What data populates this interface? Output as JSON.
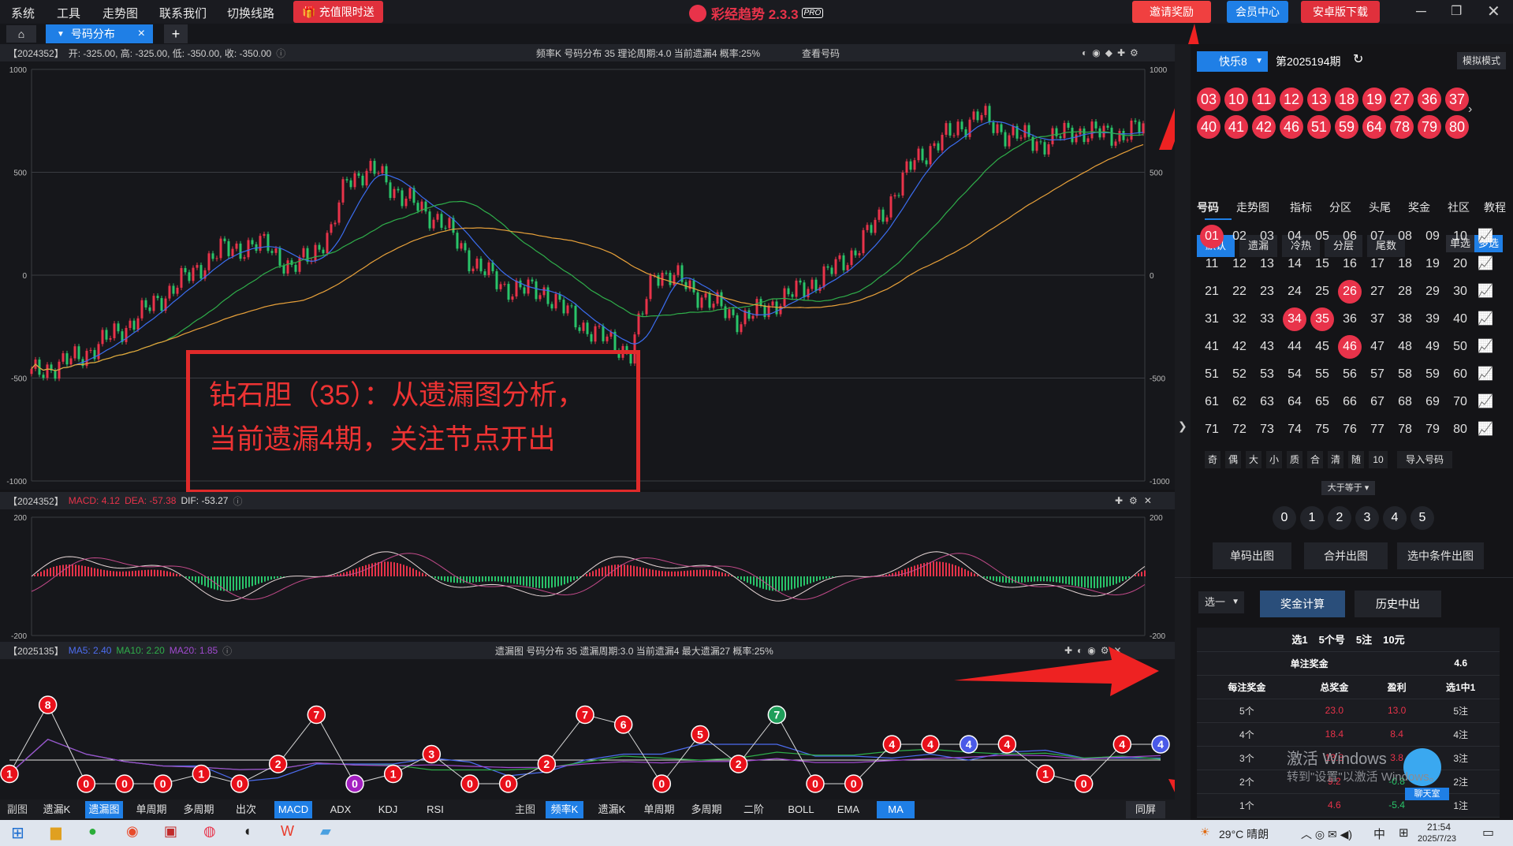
{
  "app": {
    "title": "彩经趋势 2.3.3",
    "pro": "PRO"
  },
  "menu": [
    "系统",
    "工具",
    "走势图",
    "联系我们",
    "切换线路"
  ],
  "top_buttons": {
    "recharge": "充值限时送",
    "invite": "邀请奖励",
    "member": "会员中心",
    "android": "安卓版下载"
  },
  "tabs": {
    "active": "号码分布",
    "plus": "+",
    "close": "×"
  },
  "main_chart": {
    "code": "【2024352】",
    "ohlc": "开: -325.00, 高: -325.00, 低: -350.00, 收: -350.00",
    "info": "频率K  号码分布  35    理论周期:4.0  当前遗漏4  概率:25%",
    "check": "查看号码",
    "y_ticks": [
      "1000",
      "500",
      "0",
      "-500",
      "-1000"
    ]
  },
  "annotation": {
    "line1": "钻石胆（35）：从遗漏图分析，",
    "line2": "当前遗漏4期，关注节点开出"
  },
  "macd_chart": {
    "code": "【2024352】",
    "macd": "MACD: 4.12",
    "dea": "DEA: -57.38",
    "dif": "DIF: -53.27",
    "y_ticks": [
      "200",
      "-200"
    ]
  },
  "omission_chart": {
    "code": "【2025135】",
    "ma5": "MA5: 2.40",
    "ma10": "MA10: 2.20",
    "ma20": "MA20: 1.85",
    "info": "遗漏图  号码分布  35    遗漏周期:3.0  当前遗漏4  最大遗漏27  概率:25%"
  },
  "chart_data": {
    "type": "line",
    "x_label": "期",
    "values": [
      1,
      8,
      0,
      0,
      0,
      1,
      0,
      2,
      7,
      0,
      1,
      3,
      0,
      0,
      2,
      7,
      6,
      0,
      5,
      2,
      7,
      0,
      0,
      4,
      4,
      4,
      4,
      1,
      0,
      4,
      4
    ]
  },
  "bottom_bar": {
    "left": [
      "副图",
      "遗漏K",
      "遗漏图",
      "单周期",
      "多周期",
      "出次",
      "MACD",
      "ADX",
      "KDJ",
      "RSI"
    ],
    "right": [
      "主图",
      "频率K",
      "遗漏K",
      "单周期",
      "多周期",
      "二阶",
      "BOLL",
      "EMA",
      "MA"
    ],
    "full": "同屏"
  },
  "right_panel": {
    "lottery": "快乐8",
    "period": "第2025194期",
    "mode": "模拟模式",
    "draw": [
      "03",
      "10",
      "11",
      "12",
      "13",
      "18",
      "19",
      "27",
      "36",
      "37",
      "40",
      "41",
      "42",
      "46",
      "51",
      "59",
      "64",
      "78",
      "79",
      "80"
    ],
    "nav": [
      "号码",
      "走势图",
      "指标",
      "分区",
      "头尾",
      "奖金",
      "社区",
      "教程"
    ],
    "filters": [
      "默认",
      "遗漏",
      "冷热",
      "分层",
      "尾数"
    ],
    "single": "单选",
    "multi": "多选",
    "selected": [
      "01",
      "26",
      "34",
      "35",
      "46"
    ],
    "ops": [
      "奇",
      "偶",
      "大",
      "小",
      "质",
      "合",
      "清",
      "随",
      "10",
      "导入号码"
    ],
    "compare": "大于等于",
    "counts": [
      "0",
      "1",
      "2",
      "3",
      "4",
      "5"
    ],
    "chart_buttons": [
      "单码出图",
      "合并出图",
      "选中条件出图"
    ],
    "calc": {
      "select": "选一",
      "calc": "奖金计算",
      "history": "历史中出"
    },
    "table": {
      "head": [
        "选1",
        "5个号",
        "5注",
        "10元"
      ],
      "single_label": "单注奖金",
      "single_value": "4.6",
      "cols": [
        "每注奖金",
        "总奖金",
        "盈利",
        "选1中1"
      ],
      "rows": [
        [
          "5个",
          "23.0",
          "13.0",
          "5注"
        ],
        [
          "4个",
          "18.4",
          "8.4",
          "4注"
        ],
        [
          "3个",
          "13.8",
          "3.8",
          "3注"
        ],
        [
          "2个",
          "9.2",
          "-0.8",
          "2注"
        ],
        [
          "1个",
          "4.6",
          "-5.4",
          "1注"
        ]
      ]
    },
    "chat": "聊天室"
  },
  "watermark": {
    "l1": "激活 Windows",
    "l2": "转到\"设置\"以激活 Windows。"
  },
  "taskbar": {
    "weather": "29°C 晴朗",
    "ime": "中",
    "time": "21:54",
    "date": "2025/7/23"
  }
}
